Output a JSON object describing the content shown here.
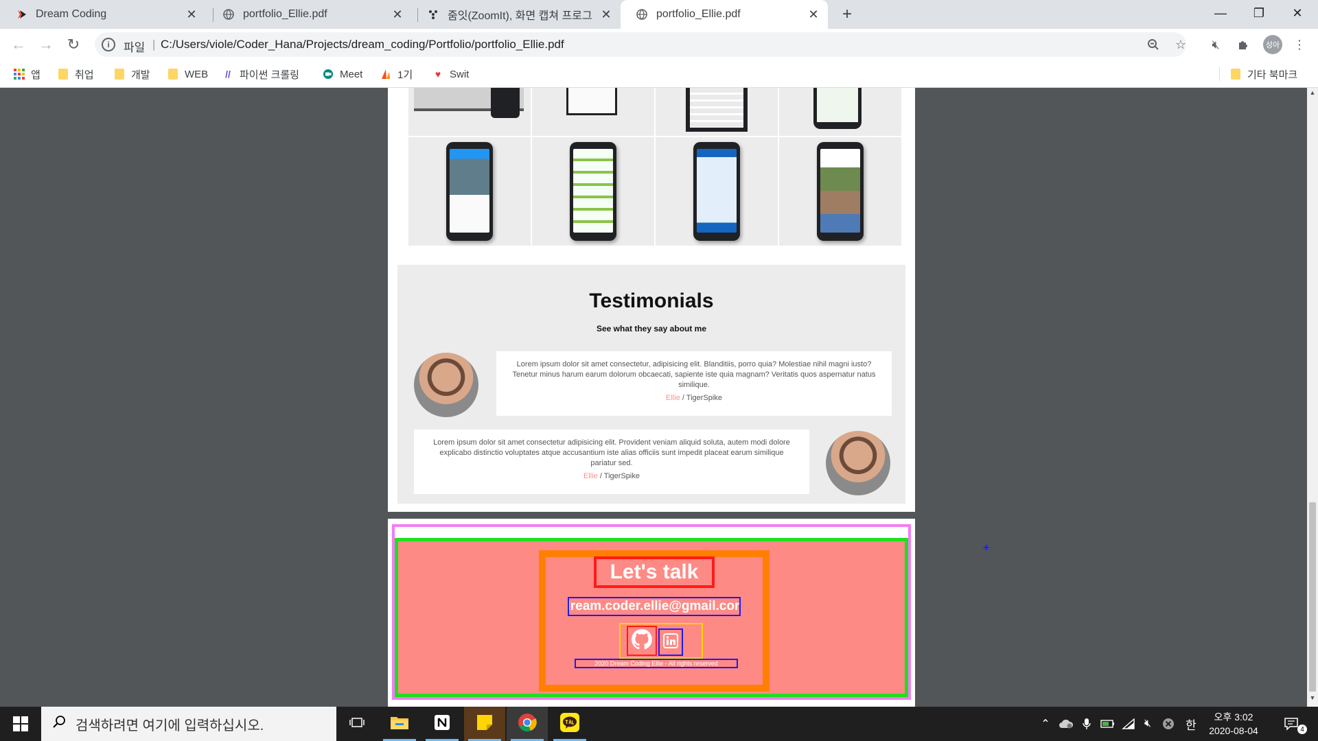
{
  "browser": {
    "tabs": [
      {
        "title": "Dream Coding",
        "icon": "dream-coding-favicon",
        "active": false
      },
      {
        "title": "portfolio_Ellie.pdf",
        "icon": "globe-icon",
        "active": false
      },
      {
        "title": "줌잇(ZoomIt), 화면 캡쳐 프로그",
        "icon": "zoomit-favicon",
        "active": false
      },
      {
        "title": "portfolio_Ellie.pdf",
        "icon": "globe-icon",
        "active": true
      }
    ],
    "new_tab_label": "+",
    "address": {
      "scheme_label": "파일",
      "url": "C:/Users/viole/Coder_Hana/Projects/dream_coding/Portfolio/portfolio_Ellie.pdf"
    },
    "profile_initials": "성아",
    "bookmarks": [
      {
        "label": "앱",
        "icon": "apps-grid-icon"
      },
      {
        "label": "취업",
        "icon": "folder-icon"
      },
      {
        "label": "개발",
        "icon": "folder-icon"
      },
      {
        "label": "WEB",
        "icon": "folder-icon"
      },
      {
        "label": "파이썬 크롤링",
        "icon": "slash-icon"
      },
      {
        "label": "Meet",
        "icon": "meet-icon"
      },
      {
        "label": "1기",
        "icon": "flame-icon"
      },
      {
        "label": "Swit",
        "icon": "heart-icon"
      }
    ],
    "other_bookmarks": "기타 북마크"
  },
  "pdf": {
    "testimonials": {
      "title": "Testimonials",
      "subtitle": "See what they say about me",
      "items": [
        {
          "text": "Lorem ipsum dolor sit amet consectetur, adipisicing elit. Blanditiis, porro quia? Molestiae nihil magni iusto? Tenetur minus harum earum dolorum obcaecati, sapiente iste quia magnam? Veritatis quos aspernatur natus similique.",
          "name": "Ellie",
          "company": " / TigerSpike"
        },
        {
          "text": "Lorem ipsum dolor sit amet consectetur adipisicing elit. Provident veniam aliquid soluta, autem modi dolore explicabo distinctio voluptates atque accusantium iste alias officiis sunt impedit placeat earum similique pariatur sed.",
          "name": "Ellie",
          "company": " / TigerSpike"
        }
      ]
    },
    "contact": {
      "title": "Let's talk",
      "email": "dream.coder.ellie@gmail.com",
      "copyright": "2020 Dream Coding Ellie - All rights reserved",
      "links": [
        {
          "icon": "github-icon"
        },
        {
          "icon": "linkedin-icon"
        }
      ]
    },
    "colors": {
      "contact_bg": "#fe8a85",
      "accent_pink": "#fe918d"
    }
  },
  "taskbar": {
    "search_placeholder": "검색하려면 여기에 입력하십시오.",
    "ime_label": "한",
    "time": "오후 3:02",
    "date": "2020-08-04",
    "notification_count": "4"
  }
}
